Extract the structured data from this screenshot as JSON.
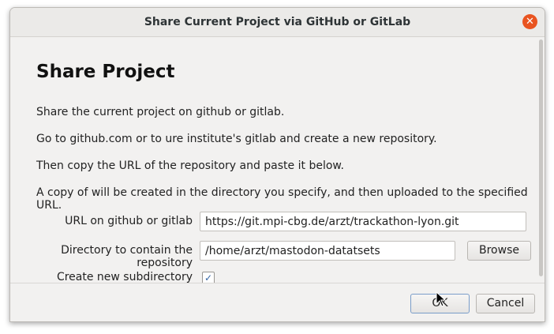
{
  "window": {
    "title": "Share Current Project via GitHub or GitLab",
    "close_glyph": "✕"
  },
  "content": {
    "heading": "Share Project",
    "paragraphs": [
      "Share the current project on github or gitlab.",
      "Go to github.com or to ure institute's gitlab and create a new repository.",
      "Then copy the URL of the repository and paste it below.",
      "A copy of will be created in the directory you specify, and then uploaded to the specified URL."
    ],
    "url_label": "URL on github or gitlab",
    "url_value": "https://git.mpi-cbg.de/arzt/trackathon-lyon.git",
    "directory_label": "Directory to contain the repository",
    "directory_value": "/home/arzt/mastodon-datatsets",
    "browse_label": "Browse",
    "subdirectory_label": "Create new subdirectory",
    "subdirectory_checked": true,
    "check_glyph": "✓"
  },
  "footer": {
    "ok_label": "OK",
    "cancel_label": "Cancel"
  },
  "colors": {
    "close_button": "#e95420",
    "checkbox_accent": "#3465a4"
  }
}
